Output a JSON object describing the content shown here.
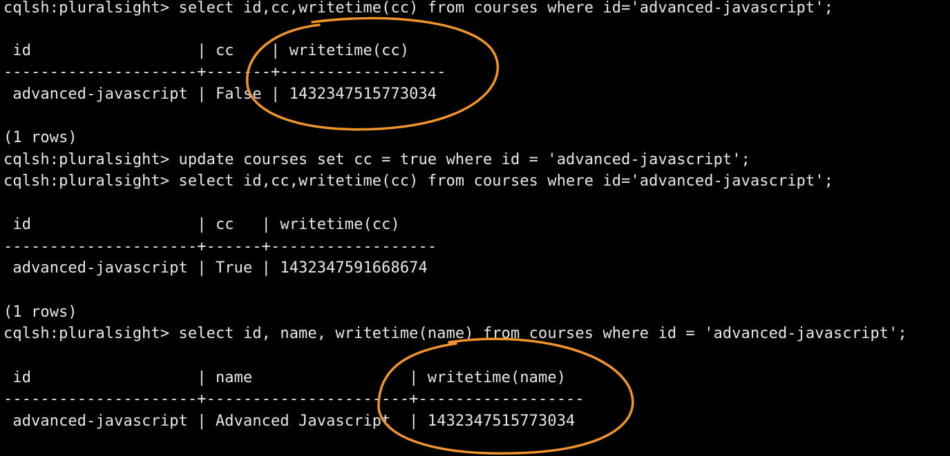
{
  "terminal": {
    "colors": {
      "background": "#000000",
      "text": "#e8e8e8",
      "annotation": "#f0952c"
    },
    "lines": [
      "cqlsh:pluralsight> select id,cc,writetime(cc) from courses where id='advanced-javascript';",
      " id                  | cc    | writetime(cc)",
      "---------------------+-------+------------------",
      " advanced-javascript | False | 1432347515773034",
      "(1 rows)",
      "cqlsh:pluralsight> update courses set cc = true where id = 'advanced-javascript';",
      "cqlsh:pluralsight> select id,cc,writetime(cc) from courses where id='advanced-javascript';",
      " id                  | cc   | writetime(cc)",
      "---------------------+------+------------------",
      " advanced-javascript | True | 1432347591668674",
      "(1 rows)",
      "cqlsh:pluralsight> select id, name, writetime(name) from courses where id = 'advanced-javascript';",
      " id                  | name                 | writetime(name)",
      "---------------------+----------------------+------------------",
      " advanced-javascript | Advanced Javascript  | 1432347515773034"
    ]
  }
}
